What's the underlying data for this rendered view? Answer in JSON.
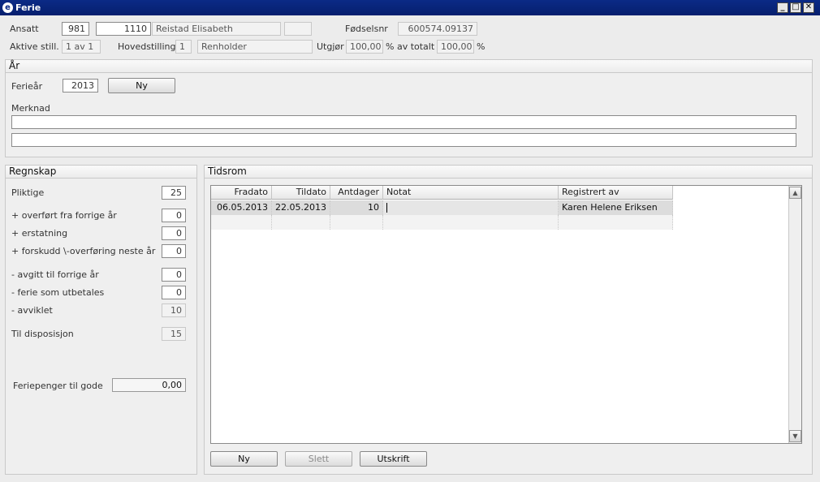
{
  "window": {
    "title": "Ferie",
    "minimize": "_",
    "maximize": "□",
    "close": "✕"
  },
  "header": {
    "ansatt_label": "Ansatt",
    "ansatt_nr": "981",
    "ansatt_id": "1110",
    "ansatt_navn": "Reistad Elisabeth",
    "ansatt_extra": "",
    "fodselsnr_label": "Fødselsnr",
    "fodselsnr": "600574.09137",
    "aktive_label": "Aktive still.",
    "aktive_value": "1 av 1",
    "hovedstilling_label": "Hovedstilling",
    "hovedstilling_nr": "1",
    "hovedstilling_navn": "Renholder",
    "utgjor_label": "Utgjør",
    "utgjor_value": "100,00",
    "av_totalt_label": "% av totalt",
    "totalt_value": "100,00",
    "pct_label": "%"
  },
  "ar_panel": {
    "title": "År",
    "ferieaar_label": "Ferieår",
    "ferieaar_value": "2013",
    "ny_button": "Ny",
    "merknad_label": "Merknad",
    "merknad_line1": "",
    "merknad_line2": ""
  },
  "regnskap": {
    "title": "Regnskap",
    "rows": [
      {
        "label": "Pliktige",
        "value": "25"
      },
      {
        "label": "+ overført fra forrige år",
        "value": "0"
      },
      {
        "label": "+ erstatning",
        "value": "0"
      },
      {
        "label": "+ forskudd \\-overføring neste år",
        "value": "0"
      },
      {
        "label": "- avgitt til forrige år",
        "value": "0"
      },
      {
        "label": "- ferie som utbetales",
        "value": "0"
      },
      {
        "label": "- avviklet",
        "value": "10"
      },
      {
        "label": "Til disposisjon",
        "value": "15"
      }
    ],
    "feriepenger_label": "Feriepenger til gode",
    "feriepenger_value": "0,00"
  },
  "tidsrom": {
    "title": "Tidsrom",
    "columns": [
      "Fradato",
      "Tildato",
      "Antdager",
      "Notat",
      "Registrert av"
    ],
    "rows": [
      [
        "06.05.2013",
        "22.05.2013",
        "10",
        "",
        "Karen Helene Eriksen"
      ]
    ],
    "buttons": {
      "ny": "Ny",
      "slett": "Slett",
      "utskrift": "Utskrift"
    },
    "scroll_up": "▲",
    "scroll_down": "▼"
  }
}
